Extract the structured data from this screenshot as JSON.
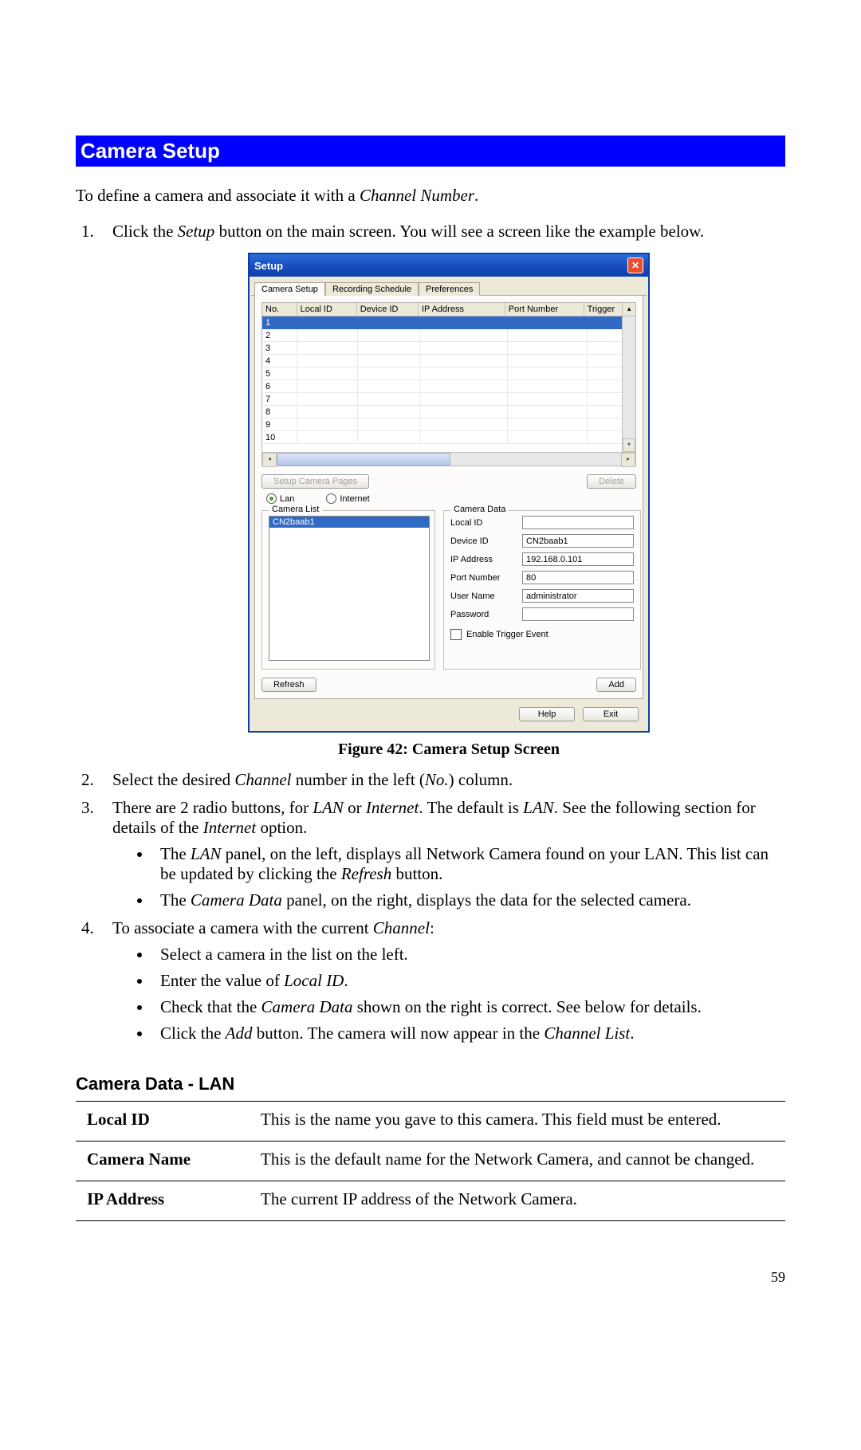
{
  "heading": "Camera Setup",
  "intro_pre": "To define a camera and associate it with a ",
  "intro_em": "Channel Number",
  "intro_post": ".",
  "step1_a": "Click the ",
  "step1_em": "Setup",
  "step1_b": " button on the main screen. You will see a screen like the example below.",
  "dialog": {
    "title": "Setup",
    "tabs": [
      "Camera Setup",
      "Recording Schedule",
      "Preferences"
    ],
    "columns": {
      "no": "No.",
      "local": "Local ID",
      "device": "Device ID",
      "ip": "IP Address",
      "port": "Port Number",
      "trigger": "Trigger"
    },
    "rows": [
      "1",
      "2",
      "3",
      "4",
      "5",
      "6",
      "7",
      "8",
      "9",
      "10"
    ],
    "setup_pages_btn": "Setup Camera Pages",
    "delete_btn": "Delete",
    "radio_lan": "Lan",
    "radio_internet": "Internet",
    "camera_list_legend": "Camera List",
    "camera_list_item": "CN2baab1",
    "camera_data_legend": "Camera Data",
    "fields": {
      "local_id": "Local ID",
      "device_id": "Device ID",
      "ip_address": "IP Address",
      "port_number": "Port Number",
      "user_name": "User Name",
      "password": "Password"
    },
    "values": {
      "local_id": "",
      "device_id": "CN2baab1",
      "ip_address": "192.168.0.101",
      "port_number": "80",
      "user_name": "administrator",
      "password": ""
    },
    "trigger_checkbox": "Enable Trigger Event",
    "refresh_btn": "Refresh",
    "add_btn": "Add",
    "help_btn": "Help",
    "exit_btn": "Exit"
  },
  "figure_caption": "Figure 42: Camera Setup Screen",
  "step2_a": "Select the desired ",
  "step2_em1": "Channel",
  "step2_b": " number in the left (",
  "step2_em2": "No.",
  "step2_c": ") column.",
  "step3_a": "There are 2 radio buttons, for ",
  "step3_em1": "LAN",
  "step3_b": " or ",
  "step3_em2": "Internet",
  "step3_c": ". The default is ",
  "step3_em3": "LAN",
  "step3_d": ". See the following section for details of the ",
  "step3_em4": "Internet",
  "step3_e": " option.",
  "step3_bullet1_a": "The ",
  "step3_bullet1_em1": "LAN",
  "step3_bullet1_b": " panel, on the left, displays all Network Camera found on your LAN. This list can be updated by clicking the ",
  "step3_bullet1_em2": "Refresh",
  "step3_bullet1_c": " button.",
  "step3_bullet2_a": "The ",
  "step3_bullet2_em": "Camera Data",
  "step3_bullet2_b": " panel, on the right, displays the data for the selected camera.",
  "step4_a": "To associate a camera with the current ",
  "step4_em": "Channel",
  "step4_b": ":",
  "step4_b1": "Select a camera in the list on the left.",
  "step4_b2_a": "Enter the value of ",
  "step4_b2_em": "Local ID",
  "step4_b2_b": ".",
  "step4_b3_a": "Check that the ",
  "step4_b3_em": "Camera Data",
  "step4_b3_b": " shown on the right is correct. See below for details.",
  "step4_b4_a": "Click the ",
  "step4_b4_em1": "Add",
  "step4_b4_b": " button. The camera will now appear in the ",
  "step4_b4_em2": "Channel List",
  "step4_b4_c": ".",
  "subheading": "Camera Data - LAN",
  "table": {
    "r1l": "Local ID",
    "r1v": "This is the name you gave to this camera. This field must be entered.",
    "r2l": "Camera Name",
    "r2v": "This is the default name for the Network Camera, and cannot be changed.",
    "r3l": "IP Address",
    "r3v": "The current IP address of the Network Camera."
  },
  "page_number": "59"
}
